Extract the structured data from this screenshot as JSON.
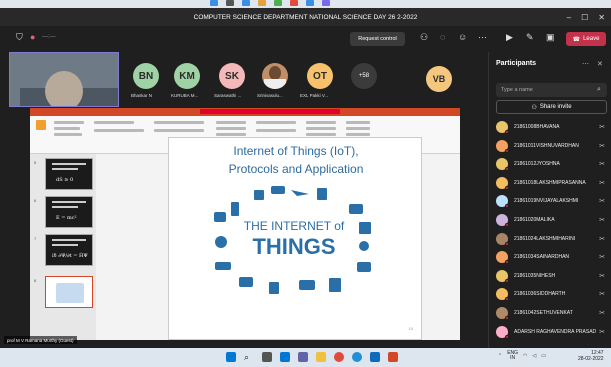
{
  "window": {
    "title": "COMPUTER SCIENCE DEPARTMENT NATIONAL SCIENCE DAY 26 2-2022",
    "controls": [
      "–",
      "☐",
      "✕"
    ]
  },
  "toolbar": {
    "request_control": "Request control",
    "leave": "Leave"
  },
  "participants_strip": [
    {
      "initials": "BN",
      "name": "Bhaskar N",
      "color": "#9fd3a5"
    },
    {
      "initials": "KM",
      "name": "KURUBA M...",
      "color": "#9fd3a5"
    },
    {
      "initials": "SK",
      "name": "Saraswathi ...",
      "color": "#f4b8b8"
    },
    {
      "initials": "",
      "name": "Srinivasulu...",
      "color": "#c08f6a"
    },
    {
      "initials": "OT",
      "name": "EXL Pakki V...",
      "color": "#f7c26b"
    }
  ],
  "more_count": "+58",
  "vb_initials": "VB",
  "slide": {
    "heading_line1": "Internet of Things (IoT),",
    "heading_line2": "Protocols and Application",
    "iot_line1": "THE INTERNET of",
    "iot_line2": "THINGS",
    "page_num": "10"
  },
  "thumbnails": [
    {
      "num": "5",
      "big": "dS ≥ 0"
    },
    {
      "num": "6",
      "big": "E = mc²"
    },
    {
      "num": "7",
      "big": "iℏ ∂Ψ/∂t = ĤΨ"
    },
    {
      "num": "8",
      "big": ""
    }
  ],
  "presenter_name": "prof M V Ramana Murthy (Guest)",
  "panel": {
    "title": "Participants",
    "search_placeholder": "Type a name",
    "share_invite": "Share invite",
    "people": [
      {
        "name": "21861008BHAVANA",
        "color": "#e9c46a"
      },
      {
        "name": "21861011VISHNUVARDHAN",
        "color": "#f4a261"
      },
      {
        "name": "21861012JYOSHNA",
        "color": "#e9c46a"
      },
      {
        "name": "21861018LAKSHMIPRASANNA",
        "color": "#f6bd60"
      },
      {
        "name": "21861019NVIJAYALAKSHMI",
        "color": "#bde0fe"
      },
      {
        "name": "21861020MALIKA",
        "color": "#cdb4db"
      },
      {
        "name": "21861024LAKSHMIHARINI",
        "color": "#a98467"
      },
      {
        "name": "21861034SAINARDHAN",
        "color": "#f4a261"
      },
      {
        "name": "21861035NIHESH",
        "color": "#e9c46a"
      },
      {
        "name": "21861036SIDDHARTH",
        "color": "#f6bd60"
      },
      {
        "name": "21861042SETHUVENKAT",
        "color": "#b08968"
      },
      {
        "name": "ADARSH RAGHAVENDRA PRASAD",
        "color": "#ffafcc"
      }
    ]
  },
  "taskbar": {
    "lang": "ENG",
    "lang2": "IN",
    "time": "12:47",
    "date": "28-02-2022"
  }
}
